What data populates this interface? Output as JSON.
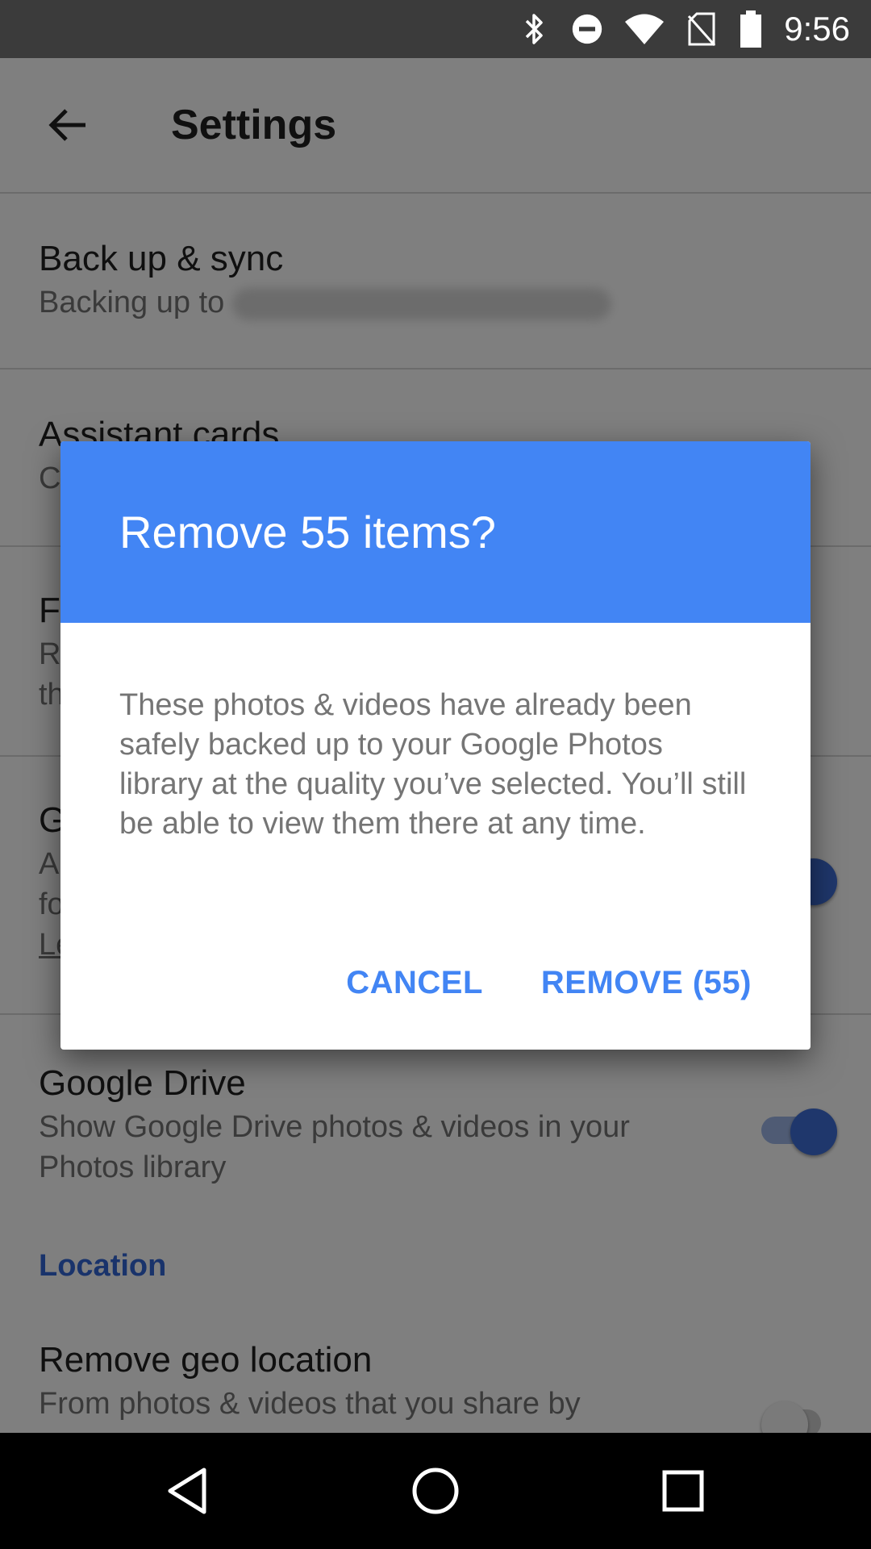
{
  "status_bar": {
    "time": "9:56",
    "icons": [
      "bluetooth-icon",
      "do-not-disturb-icon",
      "wifi-icon",
      "no-sim-icon",
      "battery-icon"
    ]
  },
  "app_bar": {
    "title": "Settings",
    "back_icon": "arrow-back-icon"
  },
  "settings": {
    "backup": {
      "title": "Back up & sync",
      "subtitle_prefix": "Backing up to"
    },
    "assistant": {
      "title": "Assistant cards",
      "subtitle_partial": "C"
    },
    "free_up": {
      "title_partial": "F",
      "subtitle_line1_partial": "R",
      "subtitle_line2_partial": "th"
    },
    "group": {
      "title_partial": "G",
      "line1_partial": "A",
      "line2_partial": "fo",
      "link_partial": "Le",
      "toggle_on": true
    },
    "google_drive": {
      "title": "Google Drive",
      "subtitle": "Show Google Drive photos & videos in your Photos library",
      "toggle_on": true
    },
    "location_header": "Location",
    "remove_geo": {
      "title": "Remove geo location",
      "subtitle": "From photos & videos that you share by",
      "toggle_on": false
    }
  },
  "dialog": {
    "title": "Remove 55 items?",
    "body": "These photos & videos have already been safely backed up to your Google Photos library at the quality you’ve selected. You’ll still be able to view them there at any time.",
    "cancel_label": "CANCEL",
    "confirm_label": "REMOVE (55)"
  },
  "nav_bar": {
    "icons": [
      "back-triangle-icon",
      "home-circle-icon",
      "recents-square-icon"
    ]
  },
  "colors": {
    "dialog_header": "#4285f4",
    "accent": "#4285f4",
    "status_bar": "#3b3b3b",
    "nav_bar": "#000000"
  }
}
